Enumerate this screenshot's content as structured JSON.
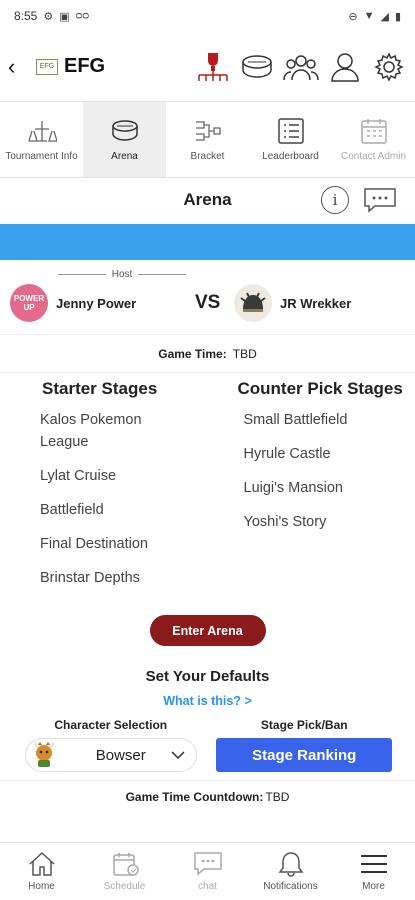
{
  "status_bar": {
    "time": "8:55",
    "left_icons": [
      "gear-icon",
      "image-icon",
      "voicemail-icon"
    ],
    "right_icons": [
      "dnd-icon",
      "wifi-icon",
      "signal-icon",
      "battery-icon"
    ]
  },
  "header": {
    "org_logo_text": "EFG",
    "org_name": "EFG"
  },
  "tabs": [
    {
      "label": "Tournament Info",
      "icon": "tournament-icon",
      "active": false
    },
    {
      "label": "Arena",
      "icon": "arena-icon",
      "active": true
    },
    {
      "label": "Bracket",
      "icon": "bracket-icon",
      "active": false
    },
    {
      "label": "Leaderboard",
      "icon": "leaderboard-icon",
      "active": false
    },
    {
      "label": "Contact Admin",
      "icon": "calendar-icon",
      "active": false
    }
  ],
  "page_title": "Arena",
  "matchup": {
    "host_label": "Host",
    "player1": {
      "name": "Jenny Power",
      "avatar_text": "POWER UP"
    },
    "vs_label": "VS",
    "player2": {
      "name": "JR Wrekker"
    }
  },
  "game_time": {
    "label": "Game Time:",
    "value": "TBD"
  },
  "stages": {
    "starter_title": "Starter Stages",
    "starter": [
      "Kalos Pokemon League",
      "Lylat Cruise",
      "Battlefield",
      "Final Destination",
      "Brinstar Depths"
    ],
    "counter_title": "Counter Pick Stages",
    "counter": [
      "Small Battlefield",
      "Hyrule Castle",
      "Luigi's Mansion",
      "Yoshi's Story"
    ]
  },
  "enter_arena_label": "Enter Arena",
  "defaults": {
    "title": "Set Your Defaults",
    "what_link": "What is this? >",
    "character_label": "Character Selection",
    "character_value": "Bowser",
    "stage_label": "Stage Pick/Ban",
    "stage_button": "Stage Ranking"
  },
  "countdown": {
    "label": "Game Time Countdown:",
    "value": "TBD"
  },
  "bottom_nav": [
    {
      "label": "Home",
      "icon": "home-icon"
    },
    {
      "label": "Schedule",
      "icon": "schedule-icon"
    },
    {
      "label": "chat",
      "icon": "chat-icon"
    },
    {
      "label": "Notifications",
      "icon": "bell-icon"
    },
    {
      "label": "More",
      "icon": "menu-icon"
    }
  ],
  "colors": {
    "accent_blue": "#39a0ee",
    "enter_button": "#8b1a1a",
    "rank_button": "#3a63ec",
    "link": "#2196f3"
  }
}
